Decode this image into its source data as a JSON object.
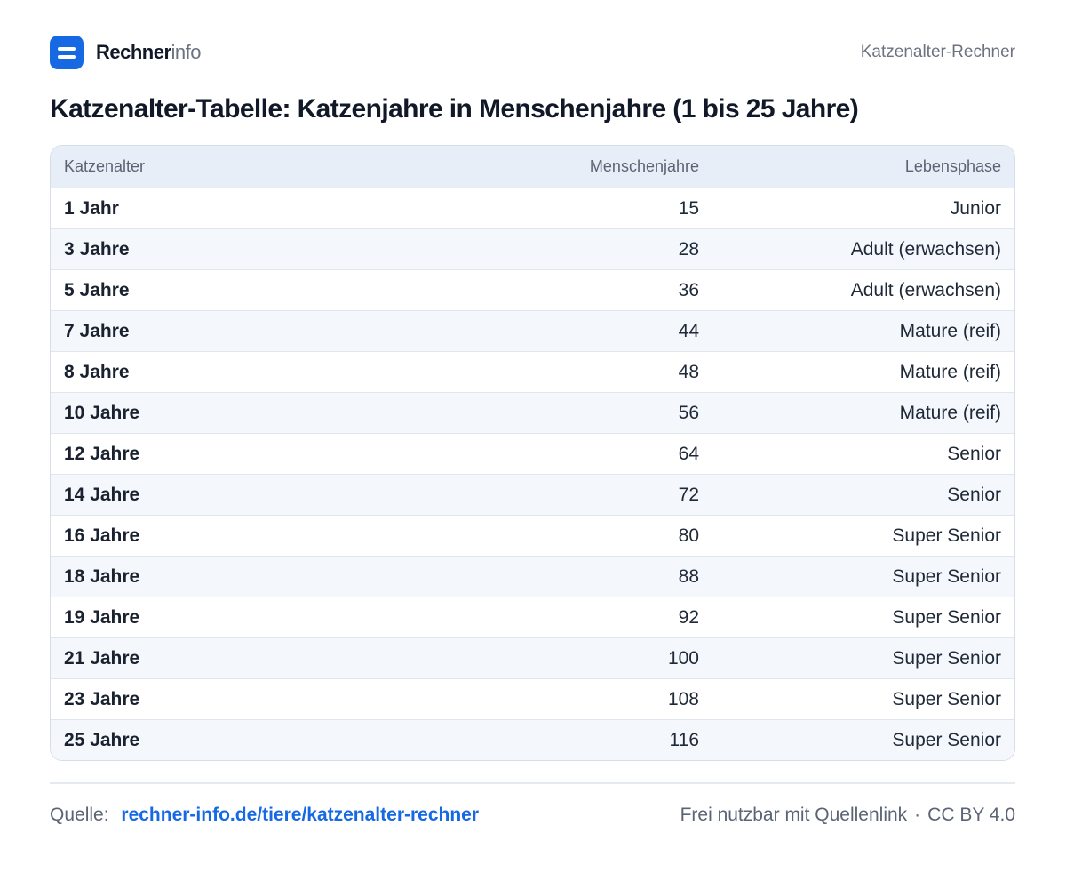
{
  "header": {
    "logo_strong": "Rechner",
    "logo_light": "info",
    "right_label": "Katzenalter-Rechner"
  },
  "title": "Katzenalter-Tabelle:  Katzenjahre in Menschenjahre (1 bis 25 Jahre)",
  "table": {
    "columns": [
      "Katzenalter",
      "Menschenjahre",
      "Lebensphase"
    ],
    "rows": [
      [
        "1 Jahr",
        "15",
        "Junior"
      ],
      [
        "3 Jahre",
        "28",
        "Adult (erwachsen)"
      ],
      [
        "5 Jahre",
        "36",
        "Adult (erwachsen)"
      ],
      [
        "7 Jahre",
        "44",
        "Mature (reif)"
      ],
      [
        "8 Jahre",
        "48",
        "Mature (reif)"
      ],
      [
        "10 Jahre",
        "56",
        "Mature (reif)"
      ],
      [
        "12 Jahre",
        "64",
        "Senior"
      ],
      [
        "14 Jahre",
        "72",
        "Senior"
      ],
      [
        "16 Jahre",
        "80",
        "Super Senior"
      ],
      [
        "18 Jahre",
        "88",
        "Super Senior"
      ],
      [
        "19 Jahre",
        "92",
        "Super Senior"
      ],
      [
        "21 Jahre",
        "100",
        "Super Senior"
      ],
      [
        "23 Jahre",
        "108",
        "Super Senior"
      ],
      [
        "25 Jahre",
        "116",
        "Super Senior"
      ]
    ]
  },
  "footer": {
    "source_label": "Quelle:",
    "source_link": "rechner-info.de/tiere/katzenalter-rechner",
    "license_text": "Frei nutzbar mit Quellenlink",
    "separator": "·",
    "license_name": "CC BY 4.0"
  },
  "colors": {
    "accent": "#1668e3",
    "header_bg": "#e8eef7",
    "alt_row_bg": "#f4f7fb"
  },
  "icons": {
    "logo": "rechner-logo-icon"
  }
}
